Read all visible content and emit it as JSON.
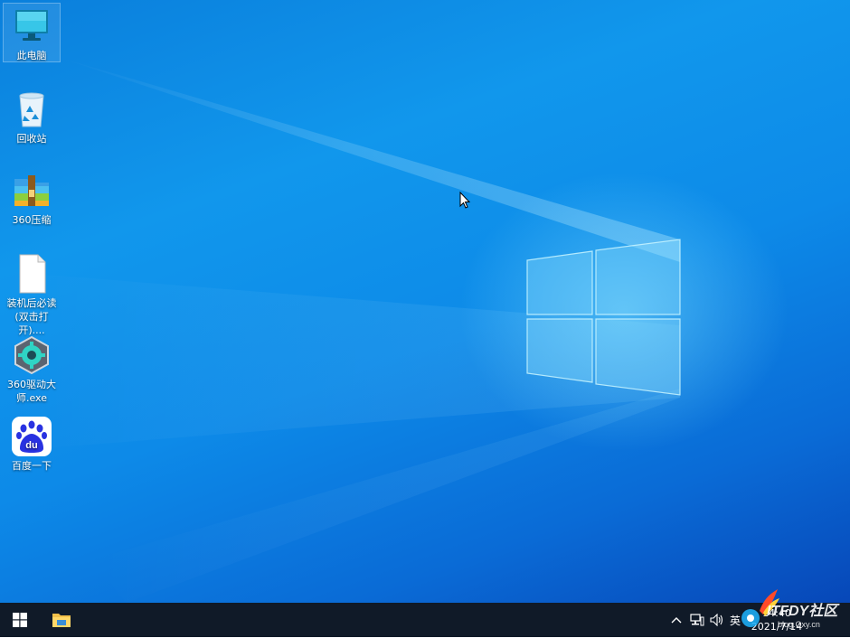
{
  "desktop": {
    "icons": [
      {
        "label": "此电脑",
        "icon": "computer-icon"
      },
      {
        "label": "回收站",
        "icon": "recycle-bin-icon"
      },
      {
        "label": "360压缩",
        "icon": "archive-icon"
      },
      {
        "label": "装机后必读(双击打开)....",
        "icon": "document-icon"
      },
      {
        "label": "360驱动大师.exe",
        "icon": "driver-gear-icon"
      },
      {
        "label": "百度一下",
        "icon": "baidu-paw-icon"
      }
    ]
  },
  "taskbar": {
    "start_icon": "windows-logo-icon",
    "pinned": [
      {
        "icon": "file-explorer-icon"
      }
    ],
    "tray": {
      "chevron": "chevron-up-icon",
      "network": "network-icon",
      "volume": "volume-icon",
      "ime": "英",
      "time": "14:40",
      "date": "2021/7/14"
    }
  },
  "watermark": {
    "brand": "ITFDY社区",
    "url": "blog.Oxy.cn"
  },
  "colors": {
    "accent": "#0a7fdc",
    "taskbar": "#101a28"
  }
}
